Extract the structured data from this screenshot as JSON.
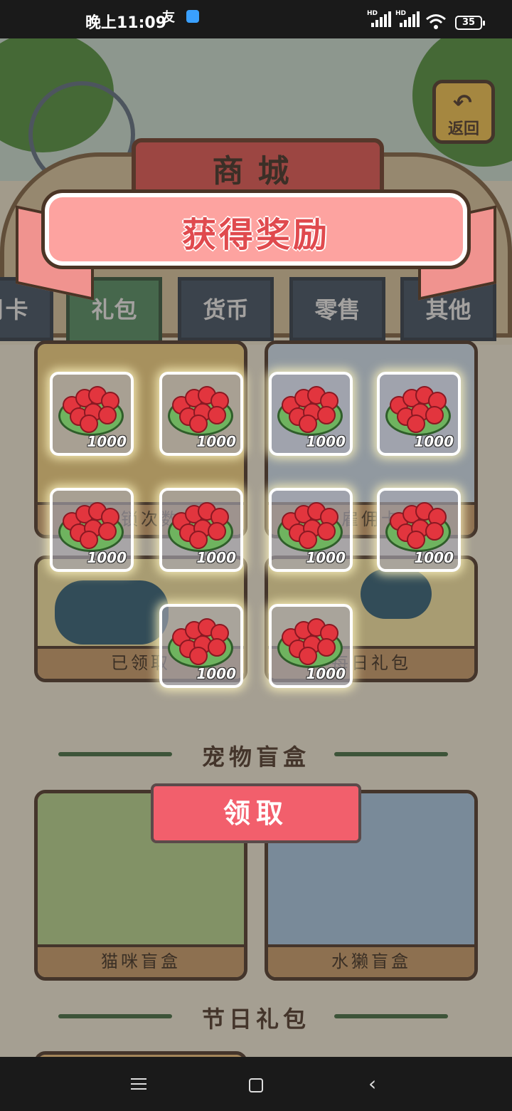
{
  "status_bar": {
    "time": "晚上11:09",
    "app_icon_a": "友",
    "battery": "35",
    "signal_1": "HD",
    "signal_2": "HD"
  },
  "shop": {
    "title": "商城",
    "back_label": "返回",
    "tabs": [
      {
        "label": "月卡"
      },
      {
        "label": "礼包",
        "active": true
      },
      {
        "label": "货币"
      },
      {
        "label": "零售"
      },
      {
        "label": "其他"
      }
    ],
    "card_captions": {
      "top_left": "解锁次数",
      "top_right": "雇佣卡",
      "mid_left": "已领取",
      "mid_right": "每日礼包",
      "pet_left": "猫咪盲盒",
      "pet_right": "水獭盲盒"
    },
    "sections": {
      "pet_blind_box": "宠物盲盒",
      "festival_gift": "节日礼包"
    }
  },
  "reward_dialog": {
    "title": "获得奖励",
    "items": [
      {
        "count": "1000"
      },
      {
        "count": "1000"
      },
      {
        "count": "1000"
      },
      {
        "count": "1000"
      },
      {
        "count": "1000"
      },
      {
        "count": "1000"
      },
      {
        "count": "1000"
      },
      {
        "count": "1000"
      },
      {
        "count": "1000"
      },
      {
        "count": "1000"
      }
    ],
    "claim_label": "领取"
  },
  "colors": {
    "ribbon": "#fda3a0",
    "ribbon_text": "#e04a4e",
    "claim_button": "#f25f6c",
    "berry": "#e2353e"
  }
}
